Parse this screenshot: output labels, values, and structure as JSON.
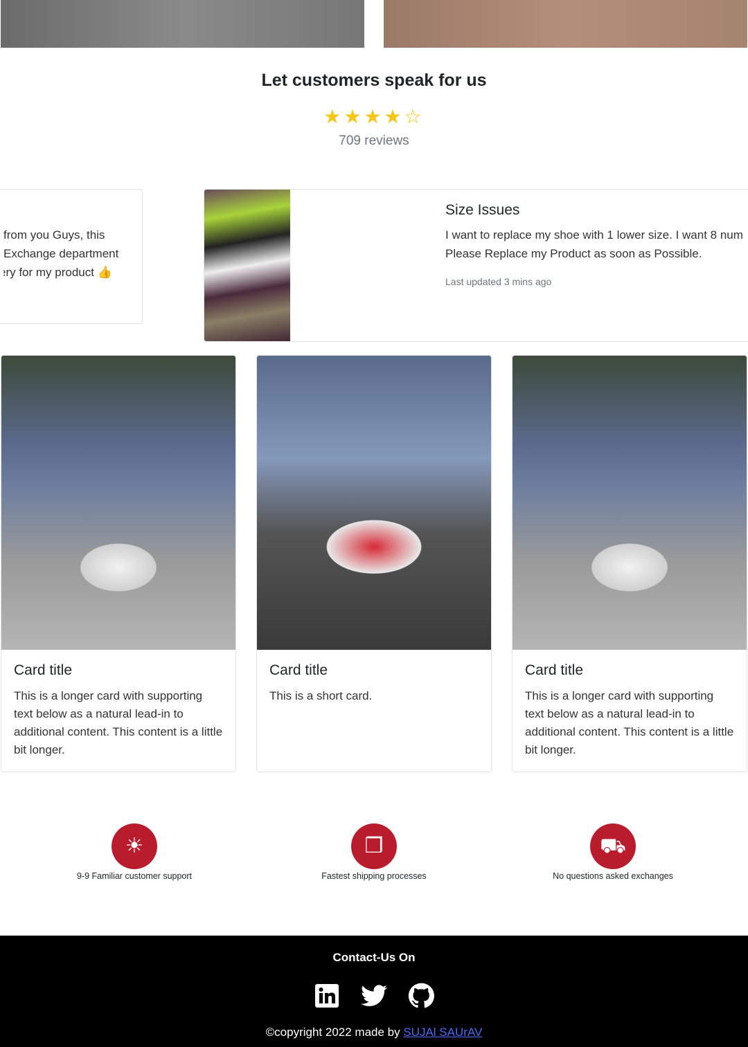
{
  "testimonials": {
    "title": "Let customers speak for us",
    "rating": 4,
    "stars": "★★★★☆",
    "reviews": "709 reviews"
  },
  "review_cards": [
    {
      "lines": [
        "from you Guys, this",
        "Exchange department",
        "ery for my product 👍"
      ]
    },
    {
      "title": "Size Issues",
      "lines": [
        "I want to replace my shoe with 1 lower size. I want 8 num",
        "Please Replace my Product as soon as Possible."
      ],
      "meta": "Last updated 3 mins ago"
    }
  ],
  "product_cards": [
    {
      "title": "Card title",
      "text": "This is a longer card with supporting text below as a natural lead-in to additional content. This content is a little bit longer."
    },
    {
      "title": "Card title",
      "text": "This is a short card."
    },
    {
      "title": "Card title",
      "text": "This is a longer card with supporting text below as a natural lead-in to additional content. This content is a little bit longer."
    }
  ],
  "features": [
    {
      "label": "9-9 Familiar customer support",
      "icon": "support-icon"
    },
    {
      "label": "Fastest shipping processes",
      "icon": "box-icon"
    },
    {
      "label": "No questions asked exchanges",
      "icon": "delivery-icon"
    }
  ],
  "footer": {
    "contact": "Contact-Us On",
    "copyright": "©copyright 2022 made by ",
    "author": "SUJAl SAUrAV"
  },
  "colors": {
    "accent": "#b91d2d",
    "star": "#f5c518",
    "link": "#4a6cf7"
  }
}
